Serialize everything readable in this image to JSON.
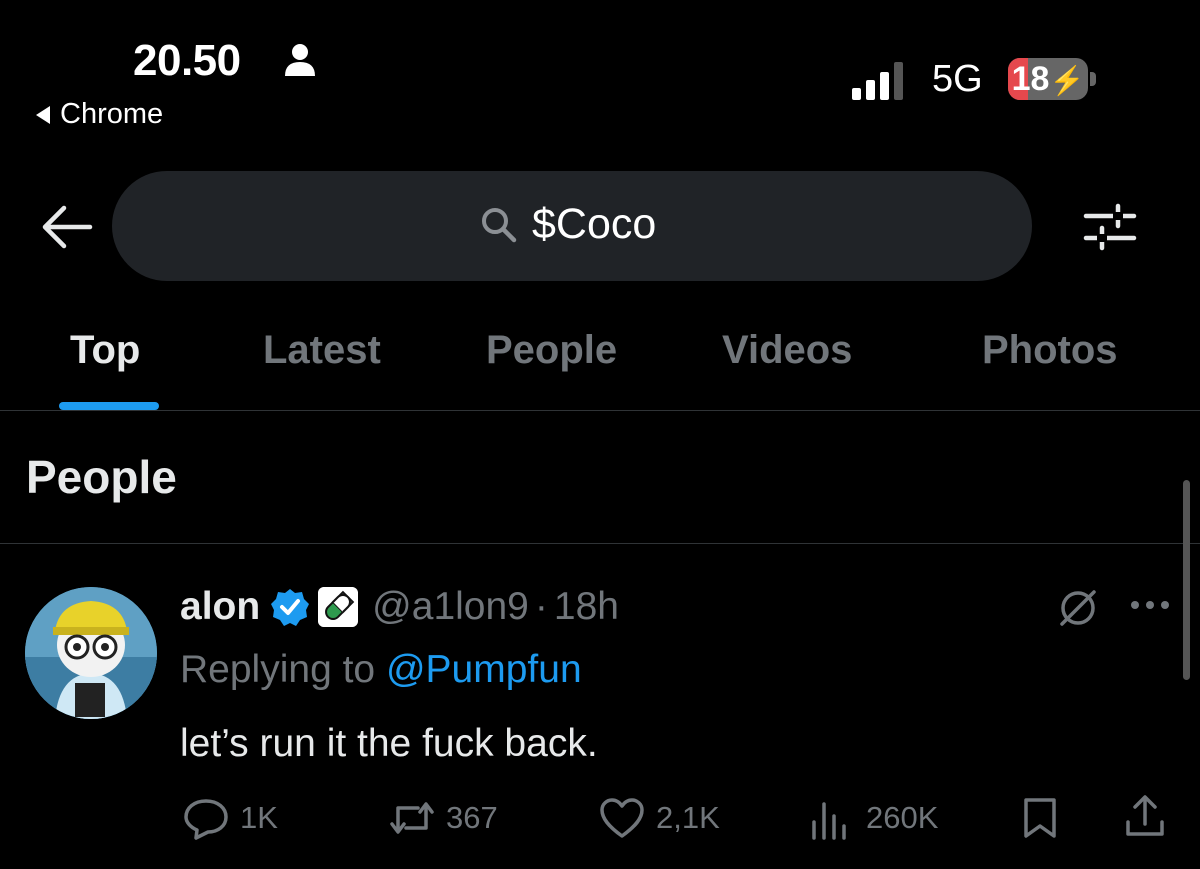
{
  "status_bar": {
    "time": "20.50",
    "back_app": "Chrome",
    "network": "5G",
    "battery": "18",
    "battery_level": 0.18
  },
  "search": {
    "query": "$Coco"
  },
  "tabs": [
    {
      "label": "Top",
      "active": true
    },
    {
      "label": "Latest",
      "active": false
    },
    {
      "label": "People",
      "active": false
    },
    {
      "label": "Videos",
      "active": false
    },
    {
      "label": "Photos",
      "active": false
    }
  ],
  "section": {
    "title": "People"
  },
  "tweet": {
    "name": "alon",
    "handle": "@a1lon9",
    "separator": "·",
    "time": "18h",
    "reply_prefix": "Replying to ",
    "reply_mention": "@Pumpfun",
    "text": "let’s run it the fuck back.",
    "actions": {
      "replies": "1K",
      "reposts": "367",
      "likes": "2,1K",
      "views": "260K"
    }
  },
  "colors": {
    "accent": "#1d9bf0",
    "muted": "#71767b",
    "background": "#000000",
    "search_bg": "#202327",
    "battery_low": "#e5484d"
  },
  "icons": [
    "person-icon",
    "back-triangle-icon",
    "signal-icon",
    "battery-icon",
    "back-arrow-icon",
    "search-icon",
    "filter-icon",
    "verified-badge-icon",
    "pill-icon",
    "grok-icon",
    "more-icon",
    "reply-icon",
    "repost-icon",
    "like-icon",
    "views-icon",
    "bookmark-icon",
    "share-icon"
  ]
}
